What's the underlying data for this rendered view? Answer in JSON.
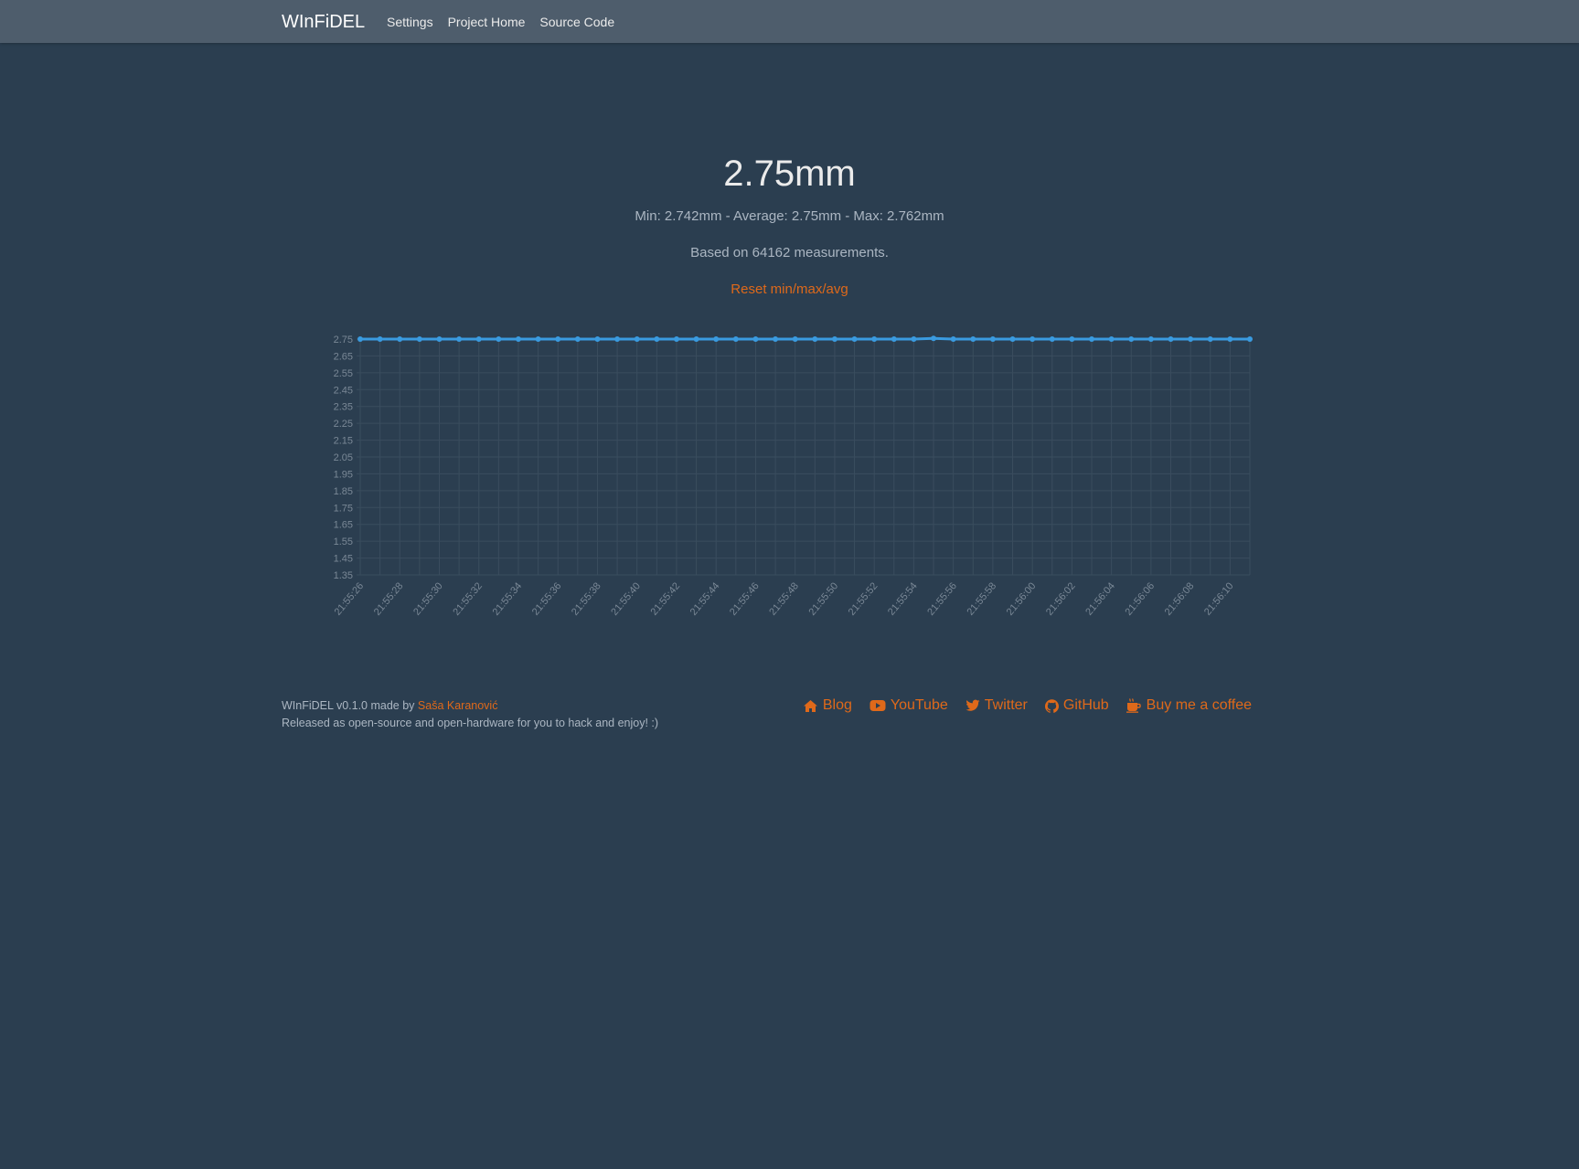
{
  "nav": {
    "brand": "WInFiDEL",
    "links": [
      "Settings",
      "Project Home",
      "Source Code"
    ]
  },
  "main": {
    "reading": "2.75mm",
    "stats": "Min: 2.742mm - Average: 2.75mm - Max: 2.762mm",
    "count": "Based on 64162 measurements.",
    "reset_label": "Reset min/max/avg"
  },
  "colors": {
    "background": "#2b3e50",
    "navbar": "#4e5d6c",
    "accent": "#df691a",
    "series": "#3a9be0"
  },
  "chart_data": {
    "type": "line",
    "title": "",
    "xlabel": "",
    "ylabel": "",
    "ylim": [
      1.35,
      2.75
    ],
    "y_ticks": [
      "2.75",
      "2.65",
      "2.55",
      "2.45",
      "2.35",
      "2.25",
      "2.15",
      "2.05",
      "1.95",
      "1.85",
      "1.75",
      "1.65",
      "1.55",
      "1.45",
      "1.35"
    ],
    "grid": true,
    "legend": "none",
    "x_labels": [
      "21:55:26",
      "21:55:28",
      "21:55:30",
      "21:55:32",
      "21:55:34",
      "21:55:36",
      "21:55:38",
      "21:55:40",
      "21:55:42",
      "21:55:44",
      "21:55:46",
      "21:55:48",
      "21:55:50",
      "21:55:52",
      "21:55:54",
      "21:55:56",
      "21:55:58",
      "21:56:00",
      "21:56:02",
      "21:56:04",
      "21:56:06",
      "21:56:08",
      "21:56:10"
    ],
    "series": [
      {
        "values": [
          2.75,
          2.75,
          2.75,
          2.75,
          2.75,
          2.75,
          2.75,
          2.75,
          2.75,
          2.75,
          2.75,
          2.75,
          2.75,
          2.75,
          2.75,
          2.75,
          2.75,
          2.75,
          2.75,
          2.75,
          2.75,
          2.75,
          2.75,
          2.75,
          2.75,
          2.75,
          2.75,
          2.75,
          2.75,
          2.754,
          2.75,
          2.75,
          2.75,
          2.75,
          2.75,
          2.75,
          2.75,
          2.75,
          2.75,
          2.75,
          2.75,
          2.75,
          2.75,
          2.75,
          2.75,
          2.75
        ]
      }
    ]
  },
  "footer": {
    "credit_prefix": "WInFiDEL v0.1.0 made by ",
    "author": "Saša Karanović",
    "tagline": "Released as open-source and open-hardware for you to hack and enjoy! :)",
    "links": [
      {
        "label": "Blog",
        "icon": "home-icon"
      },
      {
        "label": "YouTube",
        "icon": "youtube-icon"
      },
      {
        "label": "Twitter",
        "icon": "twitter-icon"
      },
      {
        "label": "GitHub",
        "icon": "github-icon"
      },
      {
        "label": "Buy me a coffee",
        "icon": "coffee-icon"
      }
    ]
  }
}
